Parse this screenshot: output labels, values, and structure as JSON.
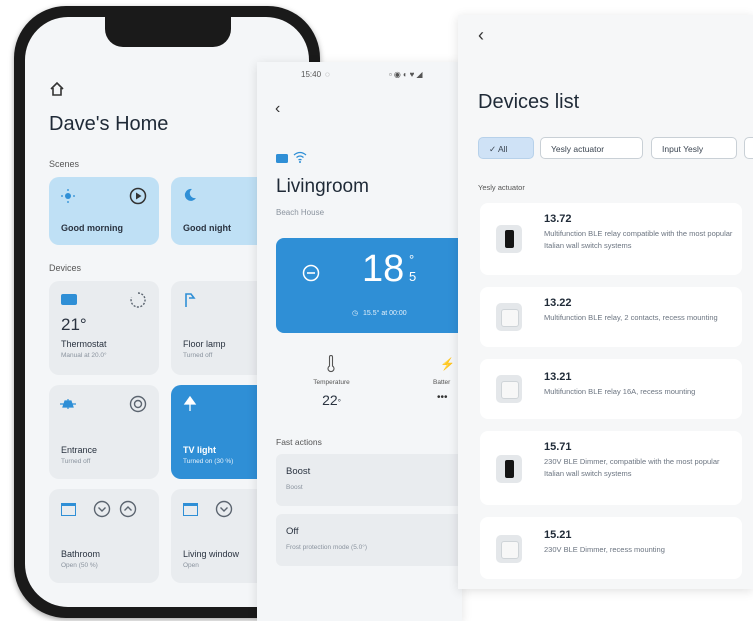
{
  "phone1": {
    "home_title": "Dave's Home",
    "scenes_label": "Scenes",
    "devices_label": "Devices",
    "scenes": [
      {
        "name": "Good morning",
        "icon": "sun-icon"
      },
      {
        "name": "Good night",
        "icon": "moon-icon"
      }
    ],
    "devices": [
      {
        "name": "Thermostat",
        "sub": "Manual at 20.0°",
        "value": "21°",
        "icon": "thermostat-icon"
      },
      {
        "name": "Floor lamp",
        "sub": "Turned off",
        "icon": "floor-lamp-icon"
      },
      {
        "name": "Entrance",
        "sub": "Turned off",
        "icon": "ceiling-light-icon"
      },
      {
        "name": "TV light",
        "sub": "Turned on (30 %)",
        "icon": "tv-light-icon"
      },
      {
        "name": "Bathroom",
        "sub": "Open (50 %)",
        "icon": "window-icon"
      },
      {
        "name": "Living window",
        "sub": "Open",
        "icon": "window-icon"
      }
    ]
  },
  "phone2": {
    "status_time": "15:40",
    "room_title": "Livingroom",
    "room_sub": "Beach House",
    "temperature_main": "18",
    "temperature_decimal": "5",
    "degree": "°",
    "setpoint": "15.5° at 00:00",
    "stat_temperature_label": "Temperature",
    "stat_temperature_value": "22",
    "stat_temperature_unit": "°",
    "stat_battery_label": "Batter",
    "stat_battery_value": "•••",
    "fast_actions_label": "Fast actions",
    "fast_actions": [
      {
        "title": "Boost",
        "sub": "Boost"
      },
      {
        "title": "Off",
        "sub": "Frost protection mode (5.0°)"
      }
    ]
  },
  "devices_list": {
    "title": "Devices list",
    "chips": [
      "All",
      "Yesly actuator",
      "Input Yesly"
    ],
    "group_label": "Yesly actuator",
    "items": [
      {
        "code": "13.72",
        "desc": "Multifunction BLE relay compatible with the most popular Italian wall switch systems",
        "img": "black"
      },
      {
        "code": "13.22",
        "desc": "Multifunction BLE relay, 2 contacts, recess mounting",
        "img": "white"
      },
      {
        "code": "13.21",
        "desc": "Multifunction BLE relay 16A, recess mounting",
        "img": "white"
      },
      {
        "code": "15.71",
        "desc": "230V BLE Dimmer, compatible with the most popular Italian wall switch systems",
        "img": "black"
      },
      {
        "code": "15.21",
        "desc": "230V BLE Dimmer, recess mounting",
        "img": "white"
      }
    ]
  },
  "colors": {
    "accent": "#2f8fd6",
    "tile_light_blue": "#bfe0f5",
    "tile_gray": "#e9ecef"
  }
}
